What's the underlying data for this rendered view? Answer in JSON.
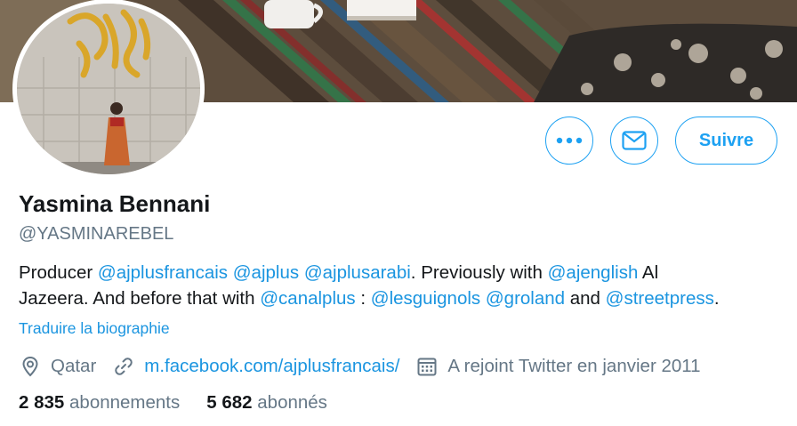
{
  "profile": {
    "name": "Yasmina Bennani",
    "handle": "@YASMINAREBEL"
  },
  "actions": {
    "more_icon": "more-dots-icon",
    "message_icon": "envelope-icon",
    "follow_label": "Suivre"
  },
  "bio": {
    "t1": "Producer ",
    "l1": "@ajplusfrancais",
    "t2": " ",
    "l2": "@ajplus",
    "t3": " ",
    "l3": "@ajplusarabi",
    "t4": ". Previously with ",
    "l4": "@ajenglish",
    "t5": " Al",
    "t6": "Jazeera. And before that with ",
    "l5": "@canalplus",
    "t7": " : ",
    "l6": "@lesguignols",
    "t8": " ",
    "l7": "@groland",
    "t9": " and ",
    "l8": "@streetpress",
    "t10": "."
  },
  "translate_label": "Traduire la biographie",
  "meta": {
    "location": "Qatar",
    "location_icon": "location-pin-icon",
    "website": "m.facebook.com/ajplusfrancais/",
    "website_icon": "link-icon",
    "joined": "A rejoint Twitter en janvier 2011",
    "joined_icon": "calendar-icon"
  },
  "stats": {
    "following_count": "2 835",
    "following_label": "abonnements",
    "followers_count": "5 682",
    "followers_label": "abonnés"
  },
  "colors": {
    "accent": "#1da1f2",
    "link": "#1b95e0",
    "secondary_text": "#657786",
    "primary_text": "#14171a"
  }
}
